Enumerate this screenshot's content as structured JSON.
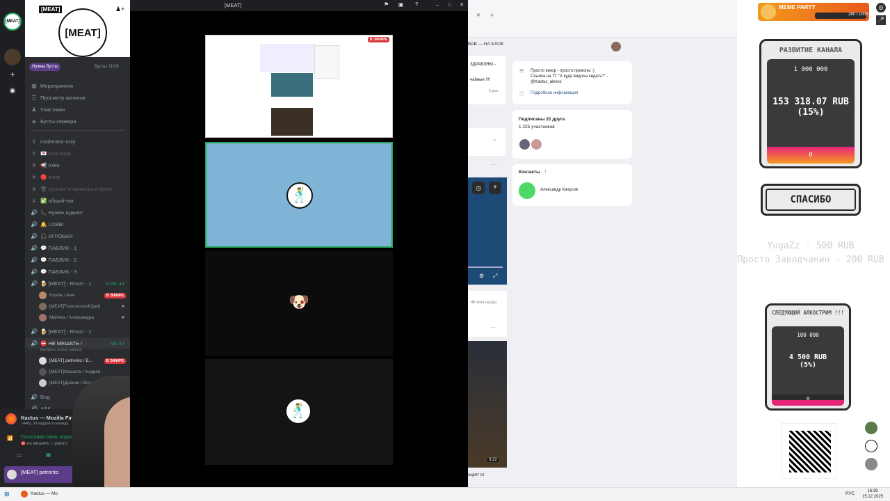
{
  "window": {
    "title": "[MEAT]"
  },
  "server": {
    "name": "[MEAT]",
    "banner_text": "[MEAT]",
    "boost_goal": "Нужны бусты",
    "boosts": "Бусты: 11/28"
  },
  "sidebar": {
    "menu": [
      {
        "label": "Мероприятия",
        "icon": "calendar-icon"
      },
      {
        "label": "Просмотр каналов",
        "icon": "channels-icon"
      },
      {
        "label": "Участники",
        "icon": "members-icon"
      },
      {
        "label": "Бусты сервера",
        "icon": "boost-icon"
      }
    ],
    "channels": [
      {
        "label": "moderator-only",
        "icon": "#",
        "style": "normal"
      },
      {
        "label": "💌 Благодар",
        "icon": "#",
        "style": "dim"
      },
      {
        "label": "📢 rules",
        "icon": "#",
        "style": "normal"
      },
      {
        "label": "🔴 meat",
        "icon": "#",
        "style": "dim"
      },
      {
        "label": "🖥 музыка-и-приколы-и-фото",
        "icon": "#",
        "style": "dim"
      },
      {
        "label": "✅ общий-чат",
        "icon": "#",
        "style": "normal"
      },
      {
        "label": "📞 Нужен Админ!",
        "icon": "🔊",
        "style": "normal"
      },
      {
        "label": "🔔 LOBBI",
        "icon": "🔊",
        "style": "normal"
      },
      {
        "label": "🎧 ИГРОВАЯ",
        "icon": "🔊",
        "style": "normal"
      },
      {
        "label": "💬 ПАБЛИК - 1",
        "icon": "🔊",
        "style": "normal"
      },
      {
        "label": "💬 ПАБЛИК - 2",
        "icon": "🔊",
        "style": "normal"
      },
      {
        "label": "💬 ПАБЛИК - 3",
        "icon": "🔊",
        "style": "normal"
      }
    ],
    "room1": {
      "label": "🍺 [MEAT] - Room - 1",
      "timer": "3:00:44"
    },
    "room1_users": [
      {
        "name": "Nusha / Аня",
        "live": "В ЭФИРЕ"
      },
      {
        "name": "[MEAT]Trancecore/Юрий",
        "live": ""
      },
      {
        "name": "Malinka / Александра",
        "live": ""
      }
    ],
    "room2": {
      "label": "🍺 [MEAT] - Room - 2"
    },
    "active": {
      "label": "⛔ НЕ МЕШАТЬ !",
      "timer": "46:57",
      "status_prompt": "Выбрать статус канала"
    },
    "active_users": [
      {
        "name": "[MEAT] petrento / В...",
        "live": "В ЭФИРЕ"
      },
      {
        "name": "[MEAT]Машков / Андрей",
        "live": ""
      },
      {
        "name": "[MEAT]Драник / Владимир",
        "live": ""
      }
    ],
    "after": [
      {
        "label": "Вид"
      },
      {
        "label": "АФК"
      }
    ]
  },
  "activity": {
    "app": "Kactus — Mozilla Firefox",
    "fps": "1440p 30 кадров в секунду",
    "voice_title": "Голосовая связь подкл",
    "voice_channel": "⛔ НЕ МЕШАТЬ ! / [MEAT]"
  },
  "me": {
    "name": "[MEAT] petrento"
  },
  "stream_badge": "В ЭФИРЕ",
  "browser": {
    "tab_label": "ВАВ — НА БЛОК",
    "post_text": "ЗДРАВЛЯЮ -",
    "post_text2": "чайные !!!!",
    "post_date": "5 дек",
    "about_text": "Просто юмор - просто приколы ;)\nСсылка на ТГ \"А куда видосы кидать?\" - @Kactus_alexxx",
    "about_link": "Подробная информация",
    "friends_title": "Подписаны 22 друга",
    "members": "1 225 участников",
    "contacts_title": "Контакты",
    "contacts_count": "1",
    "contact_name": "Александр Качусов",
    "time_ago": "48 мин назад",
    "video_duration": "3:22",
    "caption": "нцепт от"
  },
  "overlay": {
    "meme_party": "MEME PARTY",
    "party_counter": "280 / 1000",
    "goal1": {
      "title": "РАЗВИТИЕ КАНАЛА",
      "target": "1 000 000",
      "amount": "153 318.07 RUB",
      "percent": "(15%)",
      "progress": 0.15,
      "bar_label": "0"
    },
    "thanks": "СПАСИБО",
    "donations": [
      "YugaZz - 500 RUB",
      "Просто Заводчанин - 200 RUB"
    ],
    "goal2": {
      "title": "СЛЕДУЮЩИЙ АЛКОСТРИМ !!!",
      "target": "100 000",
      "amount": "4 500 RUB",
      "percent": "(5%)",
      "progress": 0.05,
      "bar_label": "0"
    }
  },
  "taskbar": {
    "item": "Kactus — Mo",
    "lang": "РУС",
    "time": "16:39",
    "date": "15.12.2025"
  },
  "colors": {
    "discord_bg": "#2b2d31",
    "accent": "#5865f2",
    "live": "#da373c",
    "online": "#23a55a",
    "tile_blue": "#7fb4d6"
  }
}
